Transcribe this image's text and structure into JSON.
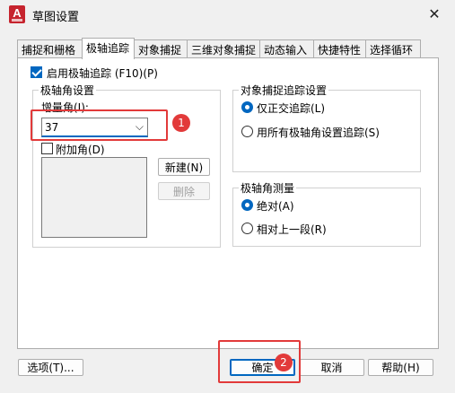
{
  "window": {
    "title": "草图设置",
    "app_icon_letter": "A",
    "close_glyph": "✕"
  },
  "tabs": [
    {
      "label": "捕捉和栅格"
    },
    {
      "label": "极轴追踪"
    },
    {
      "label": "对象捕捉"
    },
    {
      "label": "三维对象捕捉"
    },
    {
      "label": "动态输入"
    },
    {
      "label": "快捷特性"
    },
    {
      "label": "选择循环"
    }
  ],
  "polar": {
    "enable_label": "启用极轴追踪 (F10)(P)",
    "enable_checked": true,
    "settings_group": "极轴角设置",
    "increment_label": "增量角(I):",
    "increment_value": "37",
    "additional_label": "附加角(D)",
    "additional_checked": false,
    "new_button": "新建(N)",
    "delete_button": "删除"
  },
  "snap_tracking": {
    "group": "对象捕捉追踪设置",
    "option_orthogonal": "仅正交追踪(L)",
    "option_all": "用所有极轴角设置追踪(S)",
    "selected": "orthogonal"
  },
  "measurement": {
    "group": "极轴角测量",
    "option_absolute": "绝对(A)",
    "option_relative": "相对上一段(R)",
    "selected": "absolute"
  },
  "footer": {
    "options_button": "选项(T)...",
    "ok_button": "确定",
    "cancel_button": "取消",
    "help_button": "帮助(H)"
  },
  "annotations": {
    "marker1": "1",
    "marker2": "2",
    "highlight_color": "#e23a3a"
  },
  "colors": {
    "accent": "#0067c0",
    "brand": "#c6242e"
  }
}
